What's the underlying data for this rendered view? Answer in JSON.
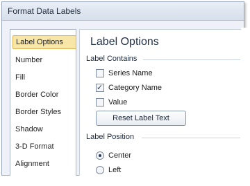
{
  "window": {
    "title": "Format Data Labels"
  },
  "sidebar": {
    "items": [
      {
        "label": "Label Options",
        "active": true
      },
      {
        "label": "Number",
        "active": false
      },
      {
        "label": "Fill",
        "active": false
      },
      {
        "label": "Border Color",
        "active": false
      },
      {
        "label": "Border Styles",
        "active": false
      },
      {
        "label": "Shadow",
        "active": false
      },
      {
        "label": "3-D Format",
        "active": false
      },
      {
        "label": "Alignment",
        "active": false
      }
    ]
  },
  "panel": {
    "title": "Label Options",
    "label_contains": {
      "heading": "Label Contains",
      "options": [
        {
          "label": "Series Name",
          "checked": false
        },
        {
          "label": "Category Name",
          "checked": true
        },
        {
          "label": "Value",
          "checked": false
        }
      ],
      "reset_button": "Reset Label Text"
    },
    "label_position": {
      "heading": "Label Position",
      "options": [
        {
          "label": "Center",
          "selected": true
        },
        {
          "label": "Left",
          "selected": false
        }
      ]
    }
  },
  "colors": {
    "active_item_bg": "#f8e6a7",
    "active_item_border": "#d9b25a",
    "panel_title": "#1f2f46"
  }
}
